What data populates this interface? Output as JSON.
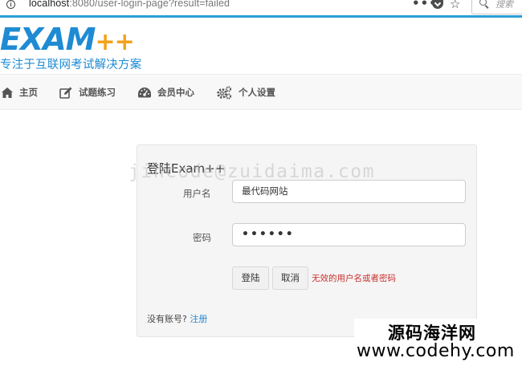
{
  "browser": {
    "url_host": "localhost",
    "url_rest": ":8080/user-login-page?result=failed",
    "menu_dots": "•••",
    "search_placeholder": "搜索"
  },
  "header": {
    "logo_text": "EXAM",
    "logo_plus": "++",
    "tagline": "专注于互联网考试解决方案",
    "colors": {
      "brand_blue": "#1e8bd3",
      "brand_orange": "#f3a21b"
    }
  },
  "nav": {
    "items": [
      {
        "label": "主页",
        "icon": "home-icon"
      },
      {
        "label": "试题练习",
        "icon": "edit-icon"
      },
      {
        "label": "会员中心",
        "icon": "dashboard-icon"
      },
      {
        "label": "个人设置",
        "icon": "gears-icon"
      }
    ]
  },
  "login": {
    "title": "登陆Exam++",
    "username_label": "用户名",
    "username_value": "最代码网站",
    "password_label": "密码",
    "password_value": "••••••",
    "login_button": "登陆",
    "cancel_button": "取消",
    "error_message": "无效的用户名或者密码",
    "no_account_text": "没有账号?",
    "register_link": "注册"
  },
  "watermarks": {
    "code_watermark": "jincode@zuidaima.com",
    "site_name": "源码海洋网",
    "site_url": "www.codehy.com"
  }
}
